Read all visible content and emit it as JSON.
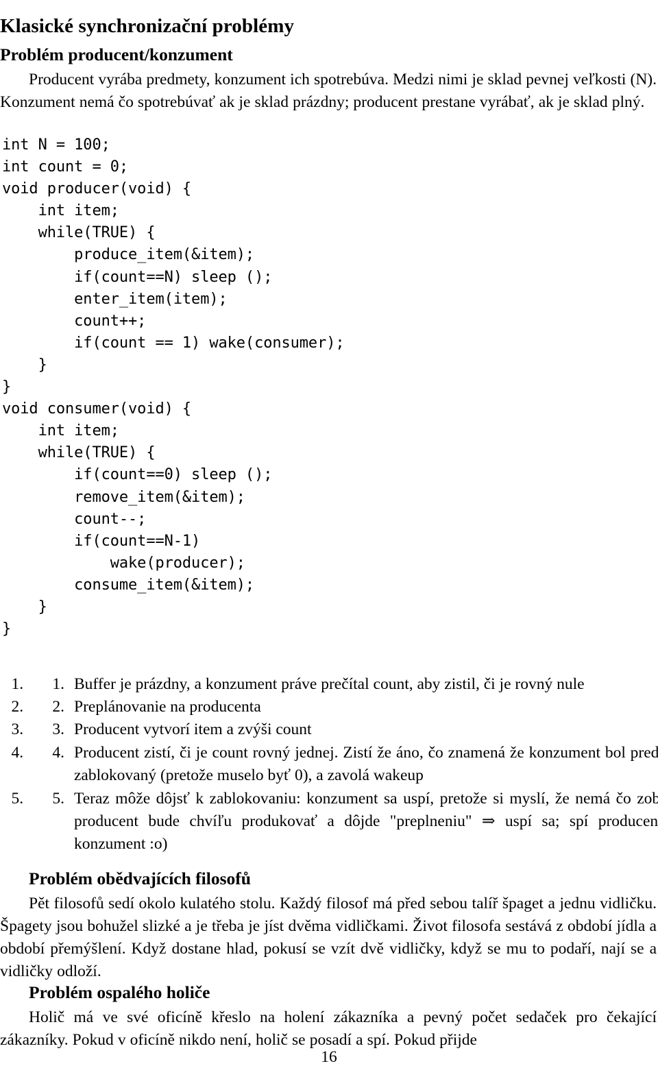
{
  "document": {
    "title": "Klasické synchronizační problémy",
    "page_number": "16"
  },
  "sections": {
    "producer_consumer": {
      "heading": "Problém producent/konzument",
      "intro_paragraph": "Producent vyrába predmety, konzument ich spotrebúva. Medzi nimi je sklad pevnej veľkosti (N). Konzument nemá čo spotrebúvať ak je sklad prázdny; producent prestane vyrábať, ak je sklad plný.",
      "code_lines": [
        "int N = 100;",
        "int count = 0;",
        "void producer(void) {",
        "    int item;",
        "    while(TRUE) {",
        "        produce_item(&item);",
        "        if(count==N) sleep ();",
        "        enter_item(item);",
        "        count++;",
        "        if(count == 1) wake(consumer);",
        "    }",
        "}",
        "void consumer(void) {",
        "    int item;",
        "    while(TRUE) {",
        "        if(count==0) sleep ();",
        "        remove_item(&item);",
        "        count--;",
        "        if(count==N-1)",
        "            wake(producer);",
        "        consume_item(&item);",
        "    }",
        "}"
      ],
      "steps": [
        {
          "number": "1.",
          "text": "Buffer je prázdny, a konzument práve prečítal count, aby zistil, či je rovný nule"
        },
        {
          "number": "2.",
          "text": "Preplánovanie na producenta"
        },
        {
          "number": "3.",
          "text": "Producent vytvorí item a zvýši count"
        },
        {
          "number": "4.",
          "text": "Producent zistí, či je count rovný jednej. Zistí že áno, čo znamená že konzument bol predtým zablokovaný (pretože muselo byť 0), a zavolá wakeup"
        },
        {
          "number": "5.",
          "text": "Teraz môže dôjsť k zablokovaniu: konzument sa uspí, pretože si myslí, že nemá čo zobrať; producent bude chvíľu produkovať a dôjde \"preplneniu\" ⇒ uspí sa; spí producent aj konzument :o)"
        }
      ]
    },
    "dining_philosophers": {
      "heading": "Problém obědvajících filosofů",
      "paragraph": "Pět filosofů sedí okolo kulatého stolu. Každý filosof má před sebou talíř špaget a jednu vidličku. Špagety jsou bohužel slizké a je třeba je jíst dvěma vidličkami. Život filosofa sestává z období jídla a období přemýšlení. Když dostane hlad, pokusí se vzít dvě vidličky, když se mu to podaří, nají se a vidličky odloží."
    },
    "sleeping_barber": {
      "heading": "Problém ospalého holiče",
      "paragraph": "Holič má ve své oficíně křeslo na holení zákazníka a pevný počet sedaček pro čekající zákazníky. Pokud v oficíně nikdo není, holič se posadí a spí. Pokud přijde"
    }
  }
}
